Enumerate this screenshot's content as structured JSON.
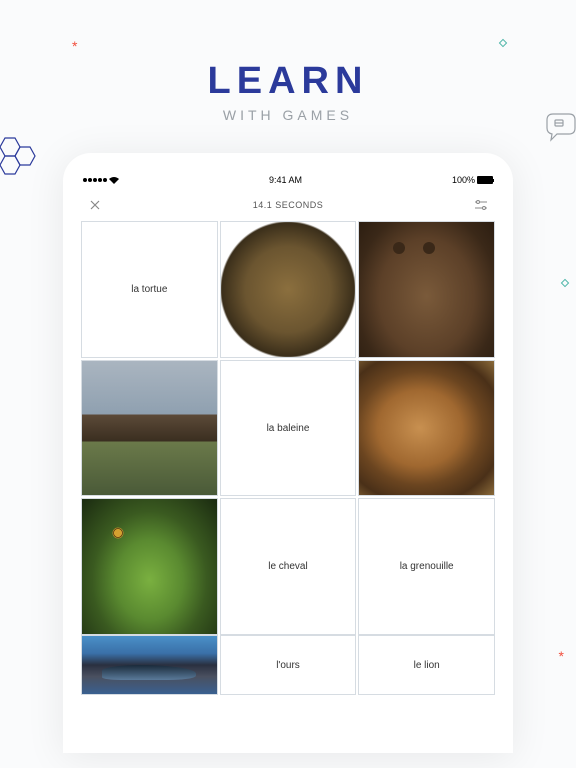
{
  "marketing": {
    "title": "LEARN",
    "subtitle": "WITH GAMES"
  },
  "statusBar": {
    "time": "9:41 AM",
    "battery": "100%"
  },
  "appHeader": {
    "timer": "14.1 SECONDS"
  },
  "cards": [
    {
      "type": "text",
      "label": "la tortue"
    },
    {
      "type": "image",
      "name": "turtle"
    },
    {
      "type": "image",
      "name": "bear"
    },
    {
      "type": "image",
      "name": "horse"
    },
    {
      "type": "text",
      "label": "la baleine"
    },
    {
      "type": "image",
      "name": "lion"
    },
    {
      "type": "image",
      "name": "frog"
    },
    {
      "type": "text",
      "label": "le cheval"
    },
    {
      "type": "text",
      "label": "la grenouille"
    },
    {
      "type": "image",
      "name": "whale"
    },
    {
      "type": "text",
      "label": "l'ours"
    },
    {
      "type": "text",
      "label": "le lion"
    }
  ]
}
